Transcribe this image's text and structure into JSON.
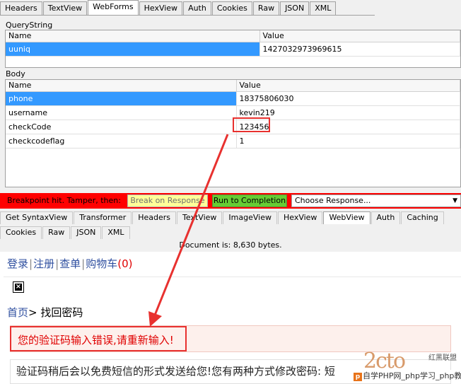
{
  "request_tabs": [
    "Headers",
    "TextView",
    "WebForms",
    "HexView",
    "Auth",
    "Cookies",
    "Raw",
    "JSON",
    "XML"
  ],
  "request_active_tab": "WebForms",
  "querystring": {
    "label": "QueryString",
    "columns": [
      "Name",
      "Value"
    ],
    "rows": [
      {
        "name": "uuniq",
        "value": "1427032973969615"
      }
    ]
  },
  "body": {
    "label": "Body",
    "columns": [
      "Name",
      "Value"
    ],
    "rows": [
      {
        "name": "phone",
        "value": "18375806030"
      },
      {
        "name": "username",
        "value": "kevin219"
      },
      {
        "name": "checkCode",
        "value": "123456"
      },
      {
        "name": "checkcodeflag",
        "value": "1"
      }
    ]
  },
  "breakpoint": {
    "message": "Breakpoint hit. Tamper, then:",
    "break_label": "Break on Response",
    "run_label": "Run to Completion",
    "choose_label": "Choose Response..."
  },
  "response_tabs_row1": [
    "Get SyntaxView",
    "Transformer",
    "Headers",
    "TextView",
    "ImageView",
    "HexView",
    "WebView",
    "Auth",
    "Caching"
  ],
  "response_tabs_row2": [
    "Cookies",
    "Raw",
    "JSON",
    "XML"
  ],
  "response_active_tab": "WebView",
  "doc_info": "Document is: 8,630 bytes.",
  "webview": {
    "nav": {
      "login": "登录",
      "register": "注册",
      "orders": "查单",
      "cart": "购物车",
      "cart_count": "(0)",
      "separator": "|"
    },
    "crumb_home": "首页",
    "crumb_rest": "> 找回密码",
    "error": "您的验证码输入错误,请重新输入!",
    "info": "验证码稍后会以免费短信的形式发送给您!您有两种方式修改密码: 短"
  },
  "watermark": {
    "logo": "2cto",
    "side": "红黑联盟",
    "line": "自学PHP网_php学习_php教"
  },
  "colors": {
    "breakpoint_bar": "#ff0000",
    "run_button": "#66cc33",
    "break_button": "#ffff99",
    "selection": "#3399ff",
    "annotation": "#e8312f",
    "link": "#3050a0"
  }
}
